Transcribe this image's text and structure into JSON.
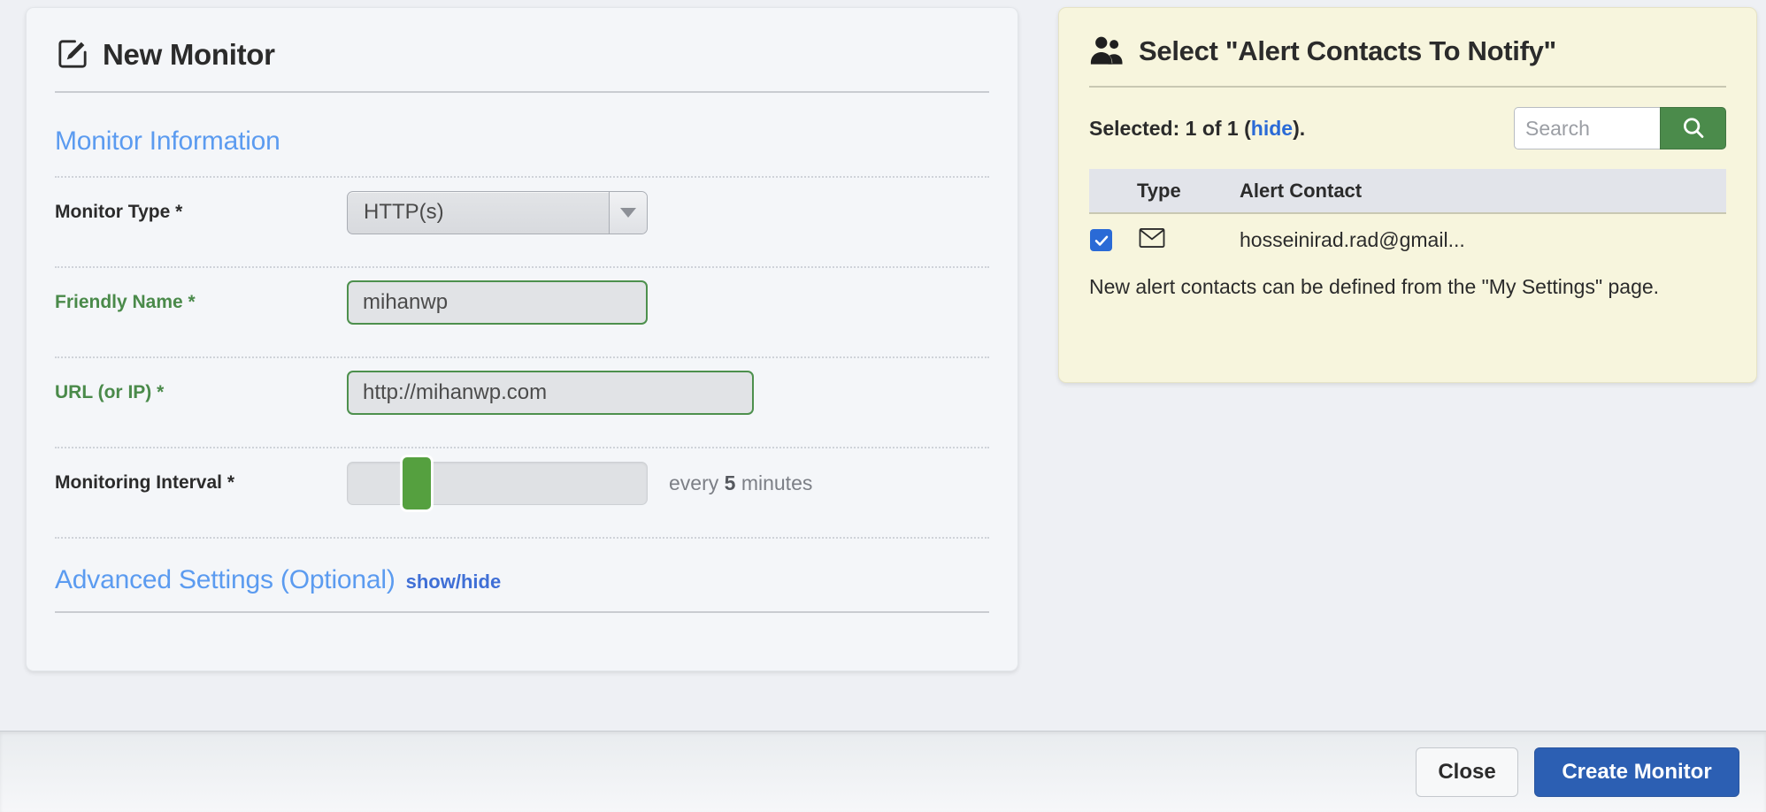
{
  "monitor_panel": {
    "title": "New Monitor",
    "icon": "edit-square-icon",
    "section_title": "Monitor Information",
    "fields": {
      "monitor_type": {
        "label": "Monitor Type *",
        "value": "HTTP(s)",
        "control": "select"
      },
      "friendly_name": {
        "label": "Friendly Name *",
        "value": "mihanwp",
        "placeholder": "",
        "state": "valid"
      },
      "url": {
        "label": "URL (or IP) *",
        "value": "http://mihanwp.com",
        "placeholder": "",
        "state": "valid"
      },
      "monitoring_interval": {
        "label": "Monitoring Interval *",
        "note_prefix": "every ",
        "note_value": "5",
        "note_suffix": " minutes",
        "slider_percent": 20
      }
    },
    "advanced": {
      "title": "Advanced Settings (Optional)",
      "toggle": "show/hide"
    }
  },
  "alerts_panel": {
    "title": "Select \"Alert Contacts To Notify\"",
    "icon": "users-icon",
    "selected_prefix": "Selected: 1 of 1 (",
    "selected_link": "hide",
    "selected_suffix": ").",
    "search": {
      "placeholder": "Search",
      "value": "",
      "button_icon": "search-icon"
    },
    "table": {
      "columns": [
        "",
        "Type",
        "Alert Contact"
      ],
      "rows": [
        {
          "checked": true,
          "type_icon": "envelope-icon",
          "contact": "hosseinirad.rad@gmail..."
        }
      ]
    },
    "note": "New alert contacts can be defined from the \"My Settings\" page."
  },
  "footer": {
    "close_label": "Close",
    "create_label": "Create Monitor"
  },
  "colors": {
    "accent_blue": "#2c5fb3",
    "link_blue": "#2a6ad6",
    "heading_blue": "#5b9bf0",
    "valid_green": "#4a8a4a",
    "slider_green": "#55a03f",
    "search_green": "#4b8b4b",
    "panel_cream": "#f7f5dd",
    "card_bg": "#f4f6f9",
    "page_bg": "#eef0f4"
  }
}
